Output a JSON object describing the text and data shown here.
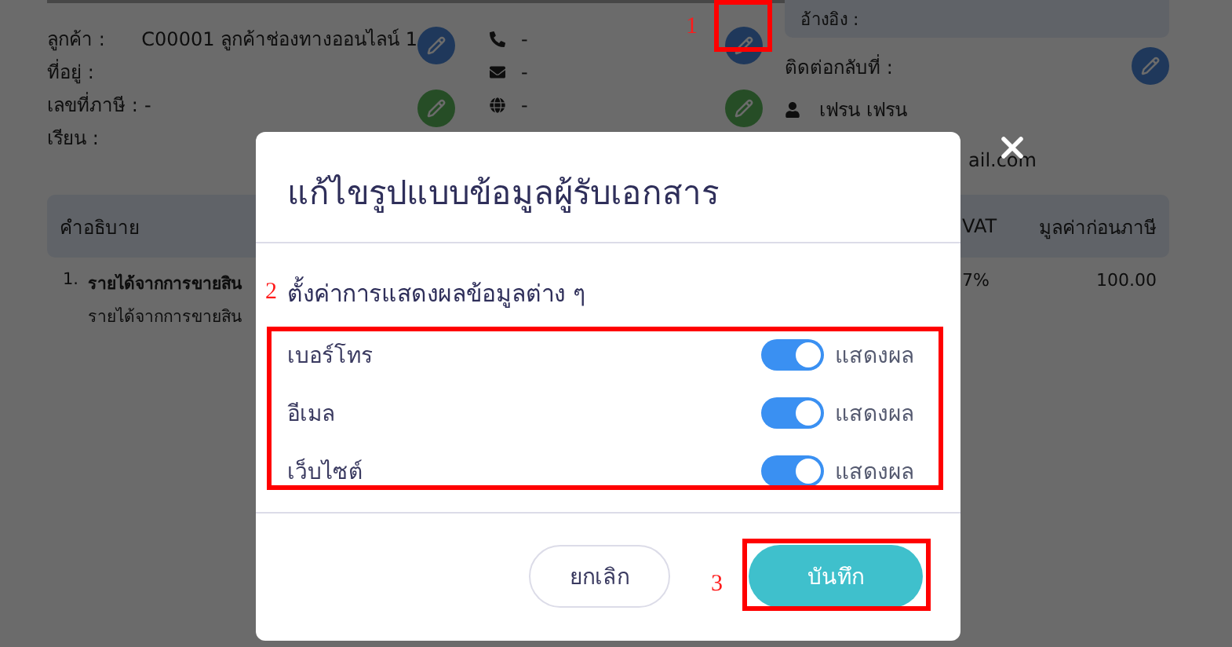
{
  "customer": {
    "fields": [
      {
        "label": "ลูกค้า :",
        "value": "C00001 ลูกค้าช่องทางออนไลน์ 1"
      },
      {
        "label": "ที่อยู่ :"
      },
      {
        "label": "เลขที่ภาษี :",
        "value": "-"
      },
      {
        "label": "เรียน :"
      }
    ],
    "contacts": [
      {
        "kind": "phone",
        "value": "-"
      },
      {
        "kind": "mail",
        "value": "-"
      },
      {
        "kind": "web",
        "value": "-"
      }
    ]
  },
  "reference": {
    "label": "อ้างอิง :"
  },
  "contact_back": {
    "label": "ติดต่อกลับที่ :",
    "name": "เฟรน เฟรน",
    "email": "ail.com"
  },
  "table": {
    "columns": [
      "คำอธิบาย",
      "VAT",
      "มูลค่าก่อนภาษี"
    ],
    "rows": [
      {
        "number": "1.",
        "description": "รายได้จากการขายสิน",
        "detail": "รายได้จากการขายสิน",
        "vat": "7%",
        "amount": "100.00"
      }
    ]
  },
  "dialog": {
    "title": "แก้ไขรูปแบบข้อมูลผู้รับเอกสาร",
    "section": "ตั้งค่าการแสดงผลข้อมูลต่าง ๆ",
    "settings": [
      {
        "label": "เบอร์โทร",
        "on": true,
        "state_label": "แสดงผล"
      },
      {
        "label": "อีเมล",
        "on": true,
        "state_label": "แสดงผล"
      },
      {
        "label": "เว็บไซต์",
        "on": true,
        "state_label": "แสดงผล"
      }
    ],
    "buttons": [
      {
        "label": "ยกเลิก",
        "kind": "secondary"
      },
      {
        "label": "บันทึก",
        "kind": "primary"
      }
    ]
  },
  "annotations": [
    {
      "number": "1"
    },
    {
      "number": "2"
    },
    {
      "number": "3"
    }
  ]
}
